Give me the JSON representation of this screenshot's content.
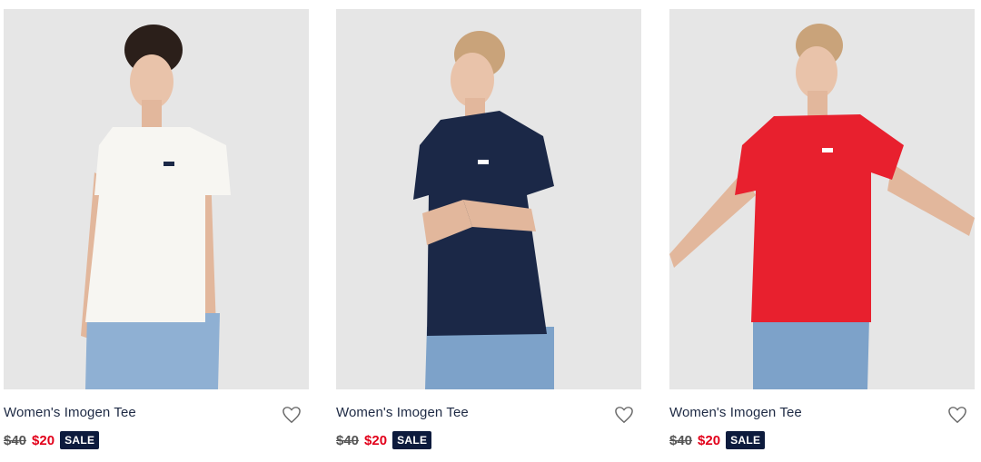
{
  "products": [
    {
      "title": "Women's Imogen Tee",
      "old_price": "$40",
      "new_price": "$20",
      "badge": "SALE",
      "shirt_color": "#f7f6f2",
      "photo_alt": "white tee"
    },
    {
      "title": "Women's Imogen Tee",
      "old_price": "$40",
      "new_price": "$20",
      "badge": "SALE",
      "shirt_color": "#1b2847",
      "photo_alt": "navy tee"
    },
    {
      "title": "Women's Imogen Tee",
      "old_price": "$40",
      "new_price": "$20",
      "badge": "SALE",
      "shirt_color": "#e8202e",
      "photo_alt": "red tee"
    }
  ],
  "colors": {
    "photo_bg": "#e6e6e6",
    "sale_price": "#e2001a",
    "badge_bg": "#0d1b3d",
    "title_text": "#1e2a44",
    "jeans": "#7da2c9",
    "skin": "#e9c3aa"
  },
  "icons": {
    "wishlist": "heart-outline-icon"
  }
}
